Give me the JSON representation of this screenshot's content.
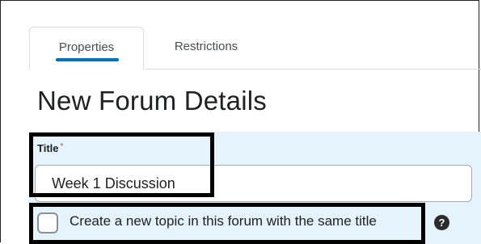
{
  "tabs": [
    {
      "label": "Properties",
      "active": true
    },
    {
      "label": "Restrictions",
      "active": false
    }
  ],
  "page_title": "New Forum Details",
  "title_field": {
    "label": "Title",
    "required_marker": "*",
    "value": "Week 1 Discussion"
  },
  "same_title_option": {
    "label": "Create a new topic in this forum with the same title",
    "checked": false
  },
  "help_icon": "?",
  "colors": {
    "accent": "#006fbf",
    "panel_background": "#e5f4fc",
    "highlight_box": "#000000"
  }
}
